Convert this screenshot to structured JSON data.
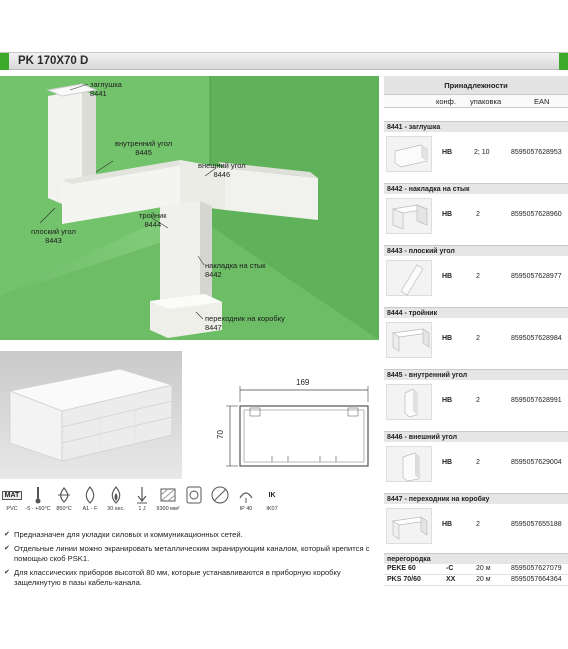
{
  "header": {
    "title": "PK 170X70 D"
  },
  "photo": {
    "callouts": [
      {
        "name": "заглушка",
        "code": "8441"
      },
      {
        "name": "внутренний угол",
        "code": "8445"
      },
      {
        "name": "внешний угол",
        "code": "8446"
      },
      {
        "name": "тройник",
        "code": "8444"
      },
      {
        "name": "плоский угол",
        "code": "8443"
      },
      {
        "name": "накладка на стык",
        "code": "8442"
      },
      {
        "name": "переходник на коробку",
        "code": "8447"
      }
    ]
  },
  "accessories": {
    "title": "Принадлежности",
    "columns": {
      "conf": "конф.",
      "pack": "упаковка",
      "ean": "EAN"
    },
    "items": [
      {
        "title": "8441 - заглушка",
        "conf": "HB",
        "pack": "2; 10",
        "ean": "8595057628953"
      },
      {
        "title": "8442 - накладка на стык",
        "conf": "HB",
        "pack": "2",
        "ean": "8595057628960"
      },
      {
        "title": "8443 - плоский угол",
        "conf": "HB",
        "pack": "2",
        "ean": "8595057628977"
      },
      {
        "title": "8444 - тройник",
        "conf": "HB",
        "pack": "2",
        "ean": "8595057628984"
      },
      {
        "title": "8445 - внутренний угол",
        "conf": "HB",
        "pack": "2",
        "ean": "8595057628991"
      },
      {
        "title": "8446 - внешний угол",
        "conf": "HB",
        "pack": "2",
        "ean": "8595057629004"
      },
      {
        "title": "8447 - переходник на коробку",
        "conf": "HB",
        "pack": "2",
        "ean": "8595057655188"
      }
    ]
  },
  "partition": {
    "title": "перегородка",
    "rows": [
      {
        "name": "PEKE 60",
        "conf": "-C",
        "pack": "20 м",
        "ean": "8595057627079"
      },
      {
        "name": "PKS 70/60",
        "conf": "XX",
        "pack": "20 м",
        "ean": "8595057664364"
      }
    ]
  },
  "drawing": {
    "width": "169",
    "height": "70"
  },
  "icons": [
    {
      "icon": "mat-icon",
      "symbol": "MAT",
      "label": "PVC"
    },
    {
      "icon": "thermometer-icon",
      "symbol": "",
      "label": "-5 - +60°C"
    },
    {
      "icon": "glow-wire-icon",
      "symbol": "",
      "label": "850°C"
    },
    {
      "icon": "flame-icon",
      "symbol": "",
      "label": "A1 - F"
    },
    {
      "icon": "fire-time-icon",
      "symbol": "",
      "label": "30 sec."
    },
    {
      "icon": "impact-icon",
      "symbol": "",
      "label": "1 J"
    },
    {
      "icon": "cross-section-icon",
      "symbol": "",
      "label": "9300 мм²"
    },
    {
      "icon": "socket-icon",
      "symbol": "",
      "label": ""
    },
    {
      "icon": "halogen-free-icon",
      "symbol": "",
      "label": ""
    },
    {
      "icon": "ip-icon",
      "symbol": "",
      "label": "IP 40"
    },
    {
      "icon": "ik-icon",
      "symbol": "IK",
      "label": "IK07"
    }
  ],
  "bullets": [
    "Предназначен для укладки силовых и коммуникационных сетей.",
    "Отдельные линии можно экранировать металлическим экранирующим каналом, который крепится с помощью скоб PSK1.",
    "Для классических приборов высотой 80 мм, которые устанавливаются в приборную коробку защелкнутую в пазы кабель-канала."
  ]
}
